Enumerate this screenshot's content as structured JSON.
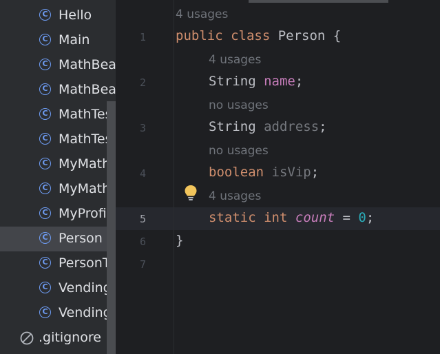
{
  "project_tree": {
    "items": [
      {
        "label": "Hello",
        "icon": "class-icon"
      },
      {
        "label": "Main",
        "icon": "class-icon"
      },
      {
        "label": "MathBea",
        "icon": "class-icon"
      },
      {
        "label": "MathBea",
        "icon": "class-icon"
      },
      {
        "label": "MathTes",
        "icon": "class-icon"
      },
      {
        "label": "MathTes",
        "icon": "class-icon"
      },
      {
        "label": "MyMath",
        "icon": "class-icon"
      },
      {
        "label": "MyMathT",
        "icon": "class-icon"
      },
      {
        "label": "MyProfile",
        "icon": "class-icon"
      },
      {
        "label": "Person",
        "icon": "class-icon",
        "selected": true
      },
      {
        "label": "PersonTe",
        "icon": "class-icon"
      },
      {
        "label": "VendingM",
        "icon": "class-icon"
      },
      {
        "label": "VendingM",
        "icon": "class-icon"
      }
    ],
    "gitignore": {
      "label": ".gitignore",
      "icon": "ignored-file-icon"
    },
    "class_icon_glyph": "C"
  },
  "editor": {
    "usage_hints": [
      "4 usages",
      "4 usages",
      "no usages",
      "no usages",
      "4 usages"
    ],
    "line_numbers": [
      "1",
      "2",
      "3",
      "4",
      "5",
      "6",
      "7"
    ],
    "current_line": "5",
    "code": {
      "l1_kw1": "public",
      "l1_kw2": "class",
      "l1_rest": " Person {",
      "l2_type": "String",
      "l2_field": "name",
      "l2_end": ";",
      "l3_type": "String",
      "l3_field": "address",
      "l3_end": ";",
      "l4_type": "boolean",
      "l4_field": "isVip",
      "l4_end": ";",
      "l5_kw1": "static",
      "l5_kw2": "int",
      "l5_field": "count",
      "l5_eq": " = ",
      "l5_num": "0",
      "l5_end": ";",
      "l6": "}"
    },
    "intention_icon": "lightbulb-icon"
  },
  "colors": {
    "keyword": "#cf8e6d",
    "field": "#c77dbb",
    "number": "#2aacb8",
    "class_icon": "#6e9df5"
  }
}
